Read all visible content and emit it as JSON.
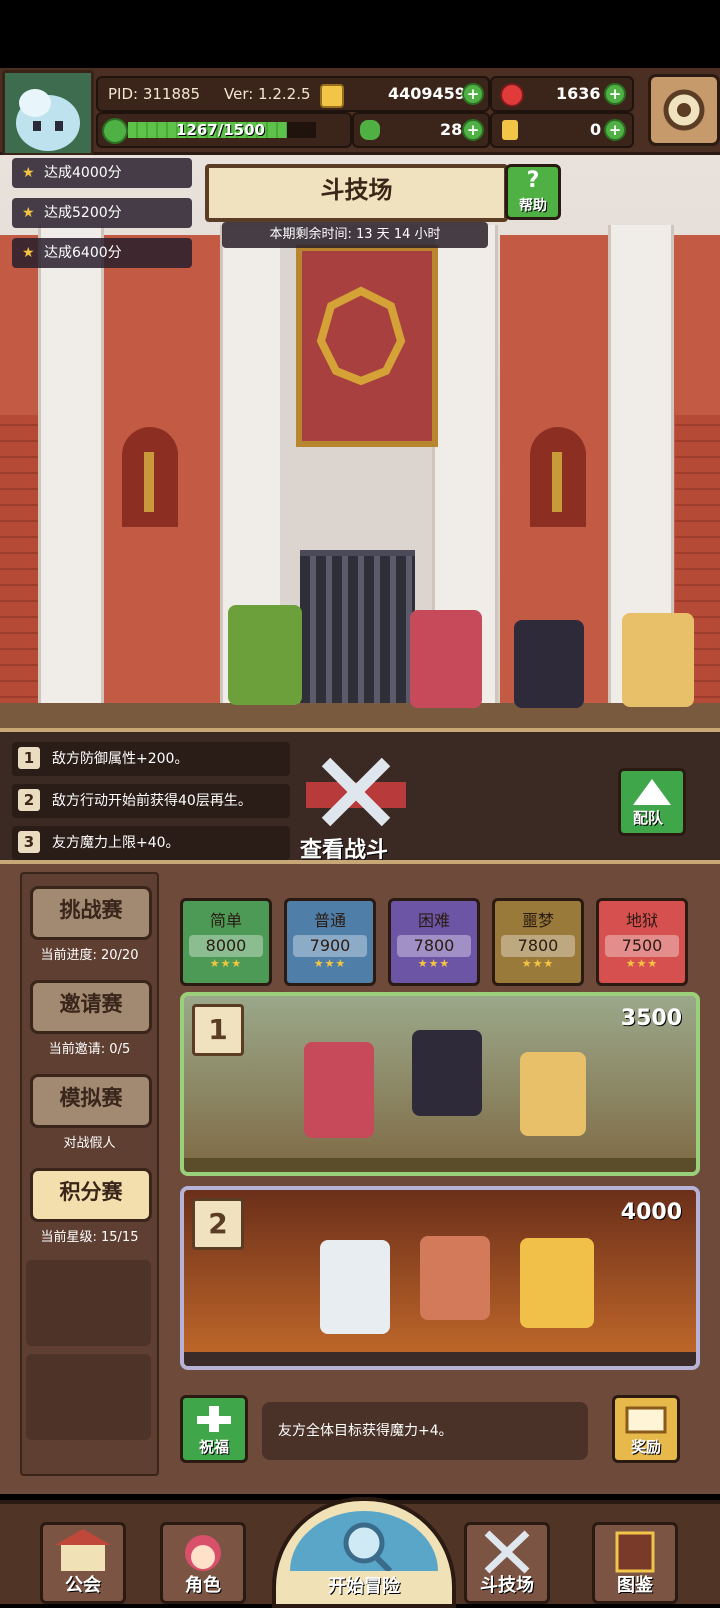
{
  "header": {
    "pid": "PID: 311885",
    "version": "Ver: 1.2.2.5",
    "gold": "4409459",
    "gems": "1636",
    "clover": "28",
    "key": "0",
    "exp_text": "1267/1500",
    "exp_progress": 0.845
  },
  "side_quests": [
    {
      "label": "达成4000分"
    },
    {
      "label": "达成5200分"
    },
    {
      "label": "达成6400分"
    }
  ],
  "arena": {
    "title": "斗技场",
    "help_label": "帮助",
    "countdown": "本期剩余时间: 13 天 14 小时"
  },
  "rules": [
    {
      "num": "1",
      "text": "敌方防御属性+200。"
    },
    {
      "num": "2",
      "text": "敌方行动开始前获得40层再生。"
    },
    {
      "num": "3",
      "text": "友方魔力上限+40。"
    }
  ],
  "view_battle_label": "查看战斗",
  "team_label": "配队",
  "modes": [
    {
      "label": "挑战赛",
      "sub": "当前进度: 20/20"
    },
    {
      "label": "邀请赛",
      "sub": "当前邀请: 0/5"
    },
    {
      "label": "模拟赛",
      "sub": "对战假人"
    },
    {
      "label": "积分赛",
      "sub": "当前星级: 15/15"
    }
  ],
  "difficulties": [
    {
      "name": "简单",
      "score": "8000",
      "stars": "★★★",
      "color": "#4d9a56"
    },
    {
      "name": "普通",
      "score": "7900",
      "stars": "★★★",
      "color": "#4f7fa8"
    },
    {
      "name": "困难",
      "score": "7800",
      "stars": "★★★",
      "color": "#6d55a6"
    },
    {
      "name": "噩梦",
      "score": "7800",
      "stars": "★★★",
      "color": "#9a7a3b"
    },
    {
      "name": "地狱",
      "score": "7500",
      "stars": "★★★",
      "color": "#d65050"
    }
  ],
  "battles": [
    {
      "num": "1",
      "score": "3500"
    },
    {
      "num": "2",
      "score": "4000"
    }
  ],
  "blessing_label": "祝福",
  "blessing_text": "友方全体目标获得魔力+4。",
  "reward_label": "奖励",
  "nav": {
    "guild": "公会",
    "character": "角色",
    "adventure": "开始冒险",
    "arena": "斗技场",
    "codex": "图鉴"
  },
  "colors": {
    "accent_green": "#4fb043",
    "panel_brown": "#6d4a39",
    "wall_red": "#c35a44"
  }
}
